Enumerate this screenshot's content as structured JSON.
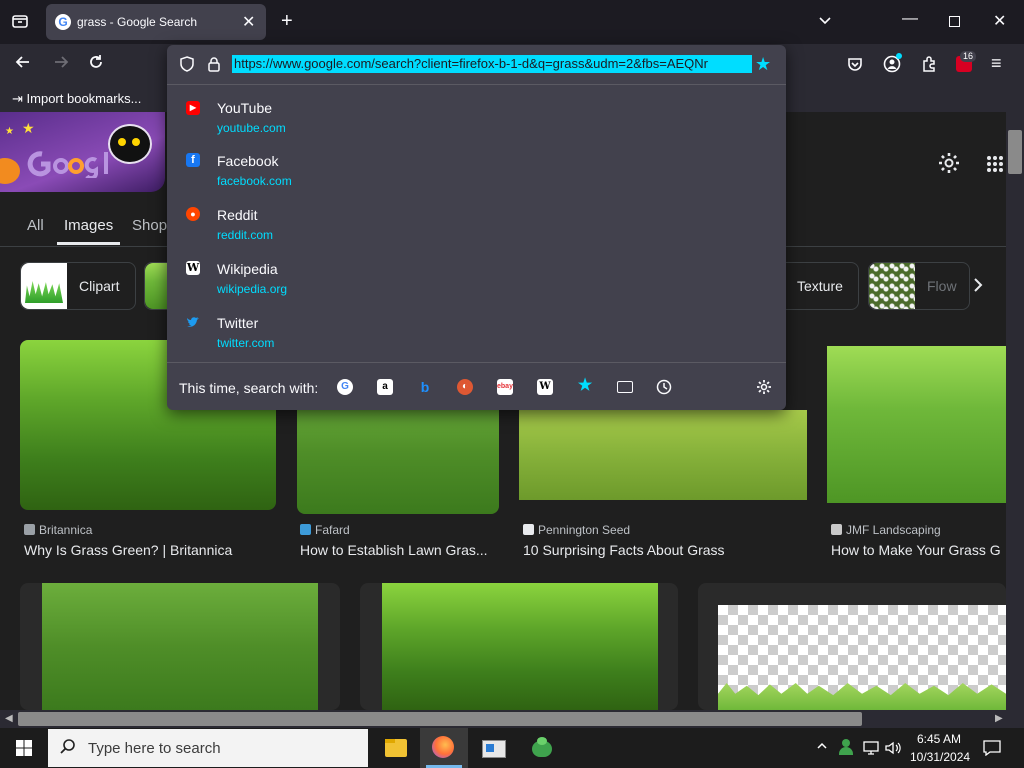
{
  "browser": {
    "tab_title": "grass - Google Search",
    "url": "https://www.google.com/search?client=firefox-b-1-d&q=grass&udm=2&fbs=AEQNr",
    "bookmark_label": "Import bookmarks...",
    "extension_badge": "16"
  },
  "google": {
    "tabs": [
      "All",
      "Images",
      "Shop"
    ],
    "active_tab": "Images",
    "chips": {
      "clipart": "Clipart",
      "texture": "Texture",
      "flowers": "Flow"
    }
  },
  "results_row1": [
    {
      "source": "Britannica",
      "caption": "Why Is Grass Green? | Britannica"
    },
    {
      "source": "Fafard",
      "caption": "How to Establish Lawn Gras..."
    },
    {
      "source": "Pennington Seed",
      "caption": "10 Surprising Facts About Grass"
    },
    {
      "source": "JMF Landscaping",
      "caption": "How to Make Your Grass G"
    }
  ],
  "suggestions": [
    {
      "title": "YouTube",
      "url": "youtube.com",
      "color": "#ff0000",
      "glyph": "▶"
    },
    {
      "title": "Facebook",
      "url": "facebook.com",
      "color": "#1877f2",
      "glyph": "f"
    },
    {
      "title": "Reddit",
      "url": "reddit.com",
      "color": "#ff4500",
      "glyph": "●"
    },
    {
      "title": "Wikipedia",
      "url": "wikipedia.org",
      "color": "#ffffff",
      "glyph": "W"
    },
    {
      "title": "Twitter",
      "url": "twitter.com",
      "color": "#1d9bf0",
      "glyph": "🐦"
    }
  ],
  "search_with": {
    "label": "This time, search with:",
    "engines": [
      "google-icon",
      "amazon-icon",
      "bing-icon",
      "duckduckgo-icon",
      "ebay-icon",
      "wikipedia-icon",
      "bookmarks-star-icon",
      "tabs-icon",
      "history-icon"
    ]
  },
  "taskbar": {
    "search_placeholder": "Type here to search",
    "time": "6:45 AM",
    "date": "10/31/2024"
  },
  "colors": {
    "accent": "#00ddff",
    "panel": "#42414d",
    "toolbar": "#2b2a33"
  }
}
